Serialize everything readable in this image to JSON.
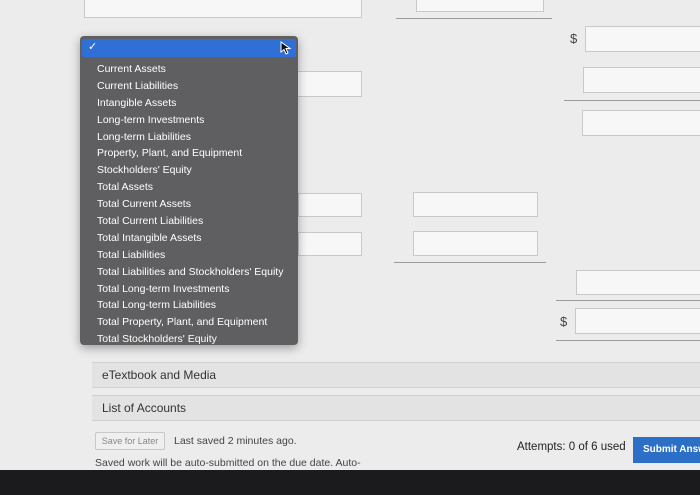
{
  "currency_symbol": "$",
  "dropdown": {
    "selected_mark": "✓",
    "options": [
      "Current Assets",
      "Current Liabilities",
      "Intangible Assets",
      "Long-term Investments",
      "Long-term Liabilities",
      "Property, Plant, and Equipment",
      "Stockholders' Equity",
      "Total Assets",
      "Total Current Assets",
      "Total Current Liabilities",
      "Total Intangible Assets",
      "Total Liabilities",
      "Total Liabilities and Stockholders' Equity",
      "Total Long-term Investments",
      "Total Long-term Liabilities",
      "Total Property, Plant, and Equipment",
      "Total Stockholders' Equity"
    ]
  },
  "panels": {
    "etextbook": "eTextbook and Media",
    "list_of_accounts": "List of Accounts"
  },
  "footer": {
    "save_label": "Save for Later",
    "last_saved": "Last saved 2 minutes ago.",
    "auto_submit_note": "Saved work will be auto-submitted on the due date. Auto-",
    "attempts": "Attempts: 0 of 6 used",
    "submit_label": "Submit Answ"
  }
}
